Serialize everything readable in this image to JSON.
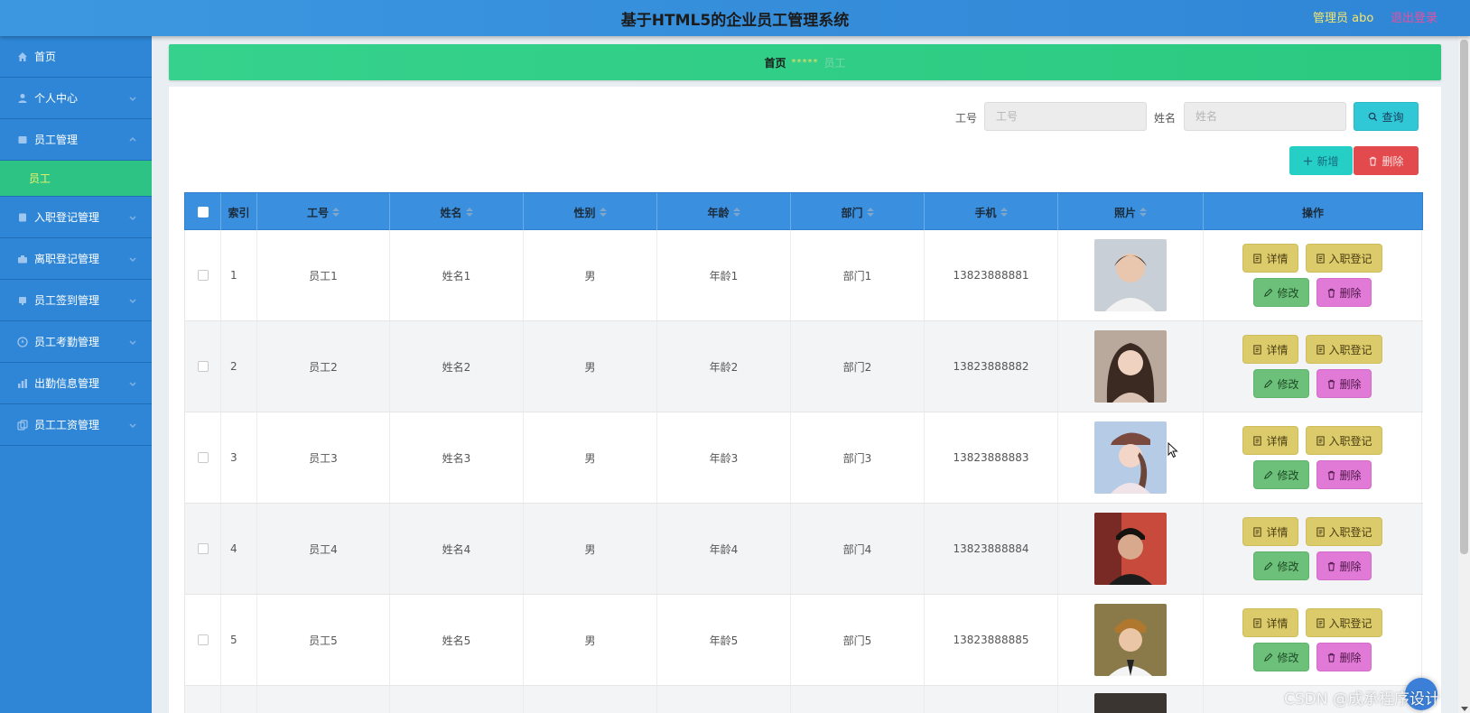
{
  "header": {
    "title": "基于HTML5的企业员工管理系统",
    "admin": "管理员 abo",
    "logout": "退出登录"
  },
  "sidebar": {
    "items": [
      {
        "label": "首页",
        "icon": "home-icon"
      },
      {
        "label": "个人中心",
        "icon": "user-icon"
      },
      {
        "label": "员工管理",
        "icon": "card-icon"
      },
      {
        "label": "入职登记管理",
        "icon": "book-icon"
      },
      {
        "label": "离职登记管理",
        "icon": "briefcase-icon"
      },
      {
        "label": "员工签到管理",
        "icon": "clipboard-icon"
      },
      {
        "label": "员工考勤管理",
        "icon": "compass-icon"
      },
      {
        "label": "出勤信息管理",
        "icon": "chart-icon"
      },
      {
        "label": "员工工资管理",
        "icon": "copy-icon"
      }
    ],
    "sub_item": "员工"
  },
  "breadcrumb": {
    "home": "首页",
    "sep": "*****",
    "current": "员工"
  },
  "search": {
    "id_label": "工号",
    "id_placeholder": "工号",
    "name_label": "姓名",
    "name_placeholder": "姓名",
    "query_label": "查询"
  },
  "actions": {
    "add_label": "新增",
    "delete_label": "删除"
  },
  "table": {
    "columns": [
      "索引",
      "工号",
      "姓名",
      "性别",
      "年龄",
      "部门",
      "手机",
      "照片",
      "操作"
    ],
    "rows": [
      {
        "index": "1",
        "id": "员工1",
        "name": "姓名1",
        "gender": "男",
        "age": "年龄1",
        "dept": "部门1",
        "phone": "13823888881"
      },
      {
        "index": "2",
        "id": "员工2",
        "name": "姓名2",
        "gender": "男",
        "age": "年龄2",
        "dept": "部门2",
        "phone": "13823888882"
      },
      {
        "index": "3",
        "id": "员工3",
        "name": "姓名3",
        "gender": "男",
        "age": "年龄3",
        "dept": "部门3",
        "phone": "13823888883"
      },
      {
        "index": "4",
        "id": "员工4",
        "name": "姓名4",
        "gender": "男",
        "age": "年龄4",
        "dept": "部门4",
        "phone": "13823888884"
      },
      {
        "index": "5",
        "id": "员工5",
        "name": "姓名5",
        "gender": "男",
        "age": "年龄5",
        "dept": "部门5",
        "phone": "13823888885"
      }
    ],
    "op_labels": {
      "detail": "详情",
      "onboard": "入职登记",
      "edit": "修改",
      "delete": "删除"
    }
  },
  "watermark": "CSDN @成承程序设计",
  "colors": {
    "header": "#3d97e0",
    "sidebar": "#2f86d6",
    "active_sub": "#2cc385",
    "breadcrumb": "#36d28d",
    "table_head": "#3a8fde"
  }
}
